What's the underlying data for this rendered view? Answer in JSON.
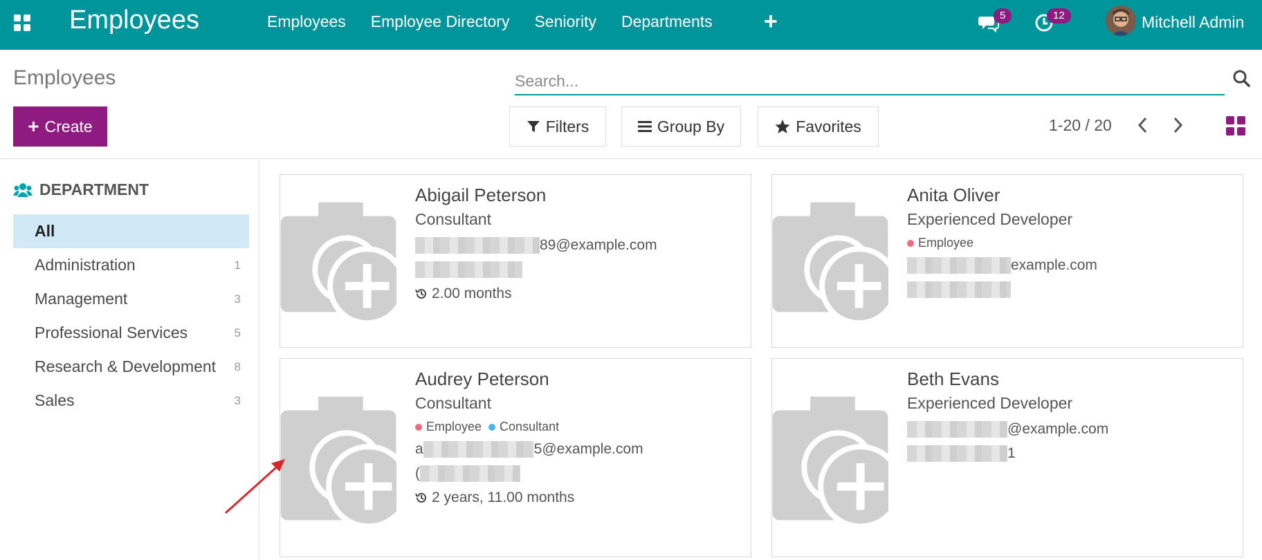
{
  "navbar": {
    "app_title": "Employees",
    "menu": [
      "Employees",
      "Employee Directory",
      "Seniority",
      "Departments"
    ],
    "add_menu_glyph": "+",
    "chat_count": "5",
    "activity_count": "12",
    "user_name": "Mitchell Admin",
    "color": "#00949b"
  },
  "control": {
    "breadcrumb": "Employees",
    "create_label": "Create",
    "search_placeholder": "Search...",
    "filters_label": "Filters",
    "groupby_label": "Group By",
    "favorites_label": "Favorites",
    "pager": "1-20 / 20",
    "accent": "#8e1c80"
  },
  "sidebar": {
    "header": "DEPARTMENT",
    "items": [
      {
        "label": "All",
        "count": ""
      },
      {
        "label": "Administration",
        "count": "1"
      },
      {
        "label": "Management",
        "count": "3"
      },
      {
        "label": "Professional Services",
        "count": "5"
      },
      {
        "label": "Research & Development",
        "count": "8"
      },
      {
        "label": "Sales",
        "count": "3"
      }
    ]
  },
  "cards": [
    {
      "name": "Abigail Peterson",
      "job": "Consultant",
      "email_visible": "89@example.com",
      "seniority": "2.00 months"
    },
    {
      "name": "Anita Oliver",
      "job": "Experienced Developer",
      "tag1": "Employee",
      "email_visible": "example.com"
    },
    {
      "name": "Audrey Peterson",
      "job": "Consultant",
      "tag1": "Employee",
      "tag2": "Consultant",
      "email_prefix": "a",
      "email_visible": "5@example.com",
      "phone_prefix": "(",
      "seniority": "2 years, 11.00 months"
    },
    {
      "name": "Beth Evans",
      "job": "Experienced Developer",
      "email_visible": "@example.com",
      "phone_suffix": "1"
    }
  ],
  "tag_colors": {
    "employee": "#ef6b7d",
    "consultant": "#4cb6e8"
  }
}
